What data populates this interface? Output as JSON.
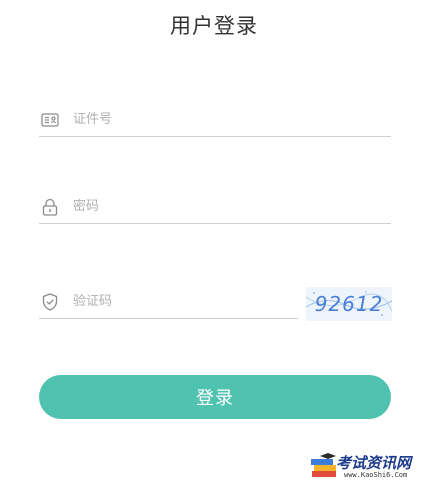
{
  "page": {
    "title": "用户登录"
  },
  "form": {
    "id_placeholder": "证件号",
    "password_placeholder": "密码",
    "captcha_placeholder": "验证码",
    "captcha_code": "92612",
    "login_label": "登录"
  },
  "icons": {
    "id": "id-card-icon",
    "password": "lock-icon",
    "captcha": "shield-check-icon"
  },
  "watermark": {
    "text": "考试资讯网",
    "url": "www.KaoShi6.Com"
  },
  "colors": {
    "accent": "#4fc2b0",
    "captcha_text": "#4a7fd4"
  }
}
